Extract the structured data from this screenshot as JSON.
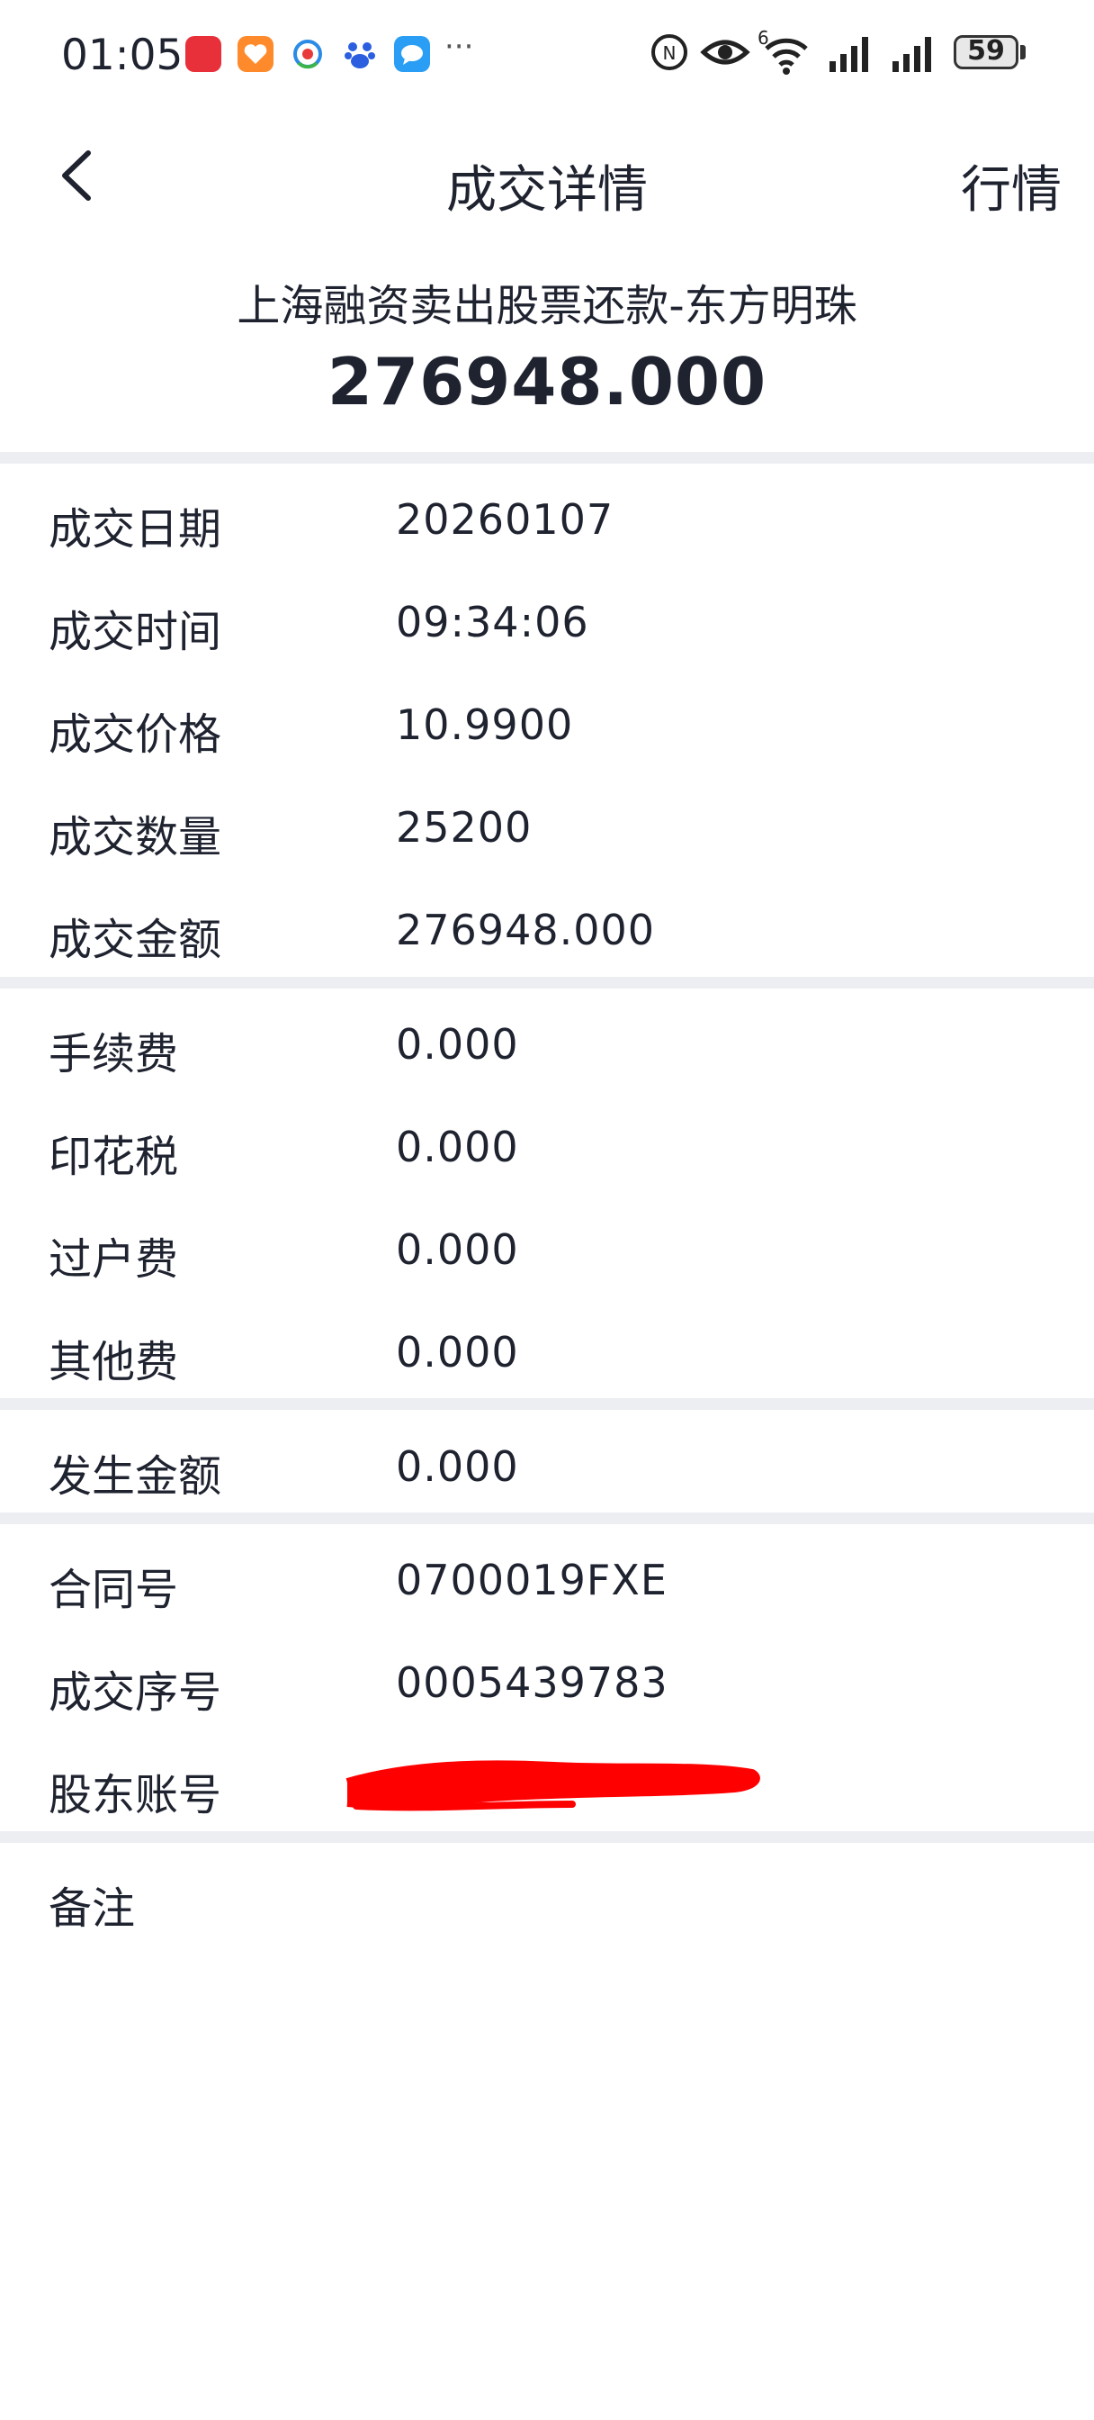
{
  "status_bar": {
    "time": "01:05",
    "battery": "59",
    "network_badge": "6",
    "icons": [
      "huawei-app-icon",
      "health-app-icon",
      "colorful-app-icon",
      "baidu-app-icon",
      "message-app-icon",
      "more-dots-icon",
      "nfc-icon",
      "eye-icon",
      "wifi-icon",
      "signal-icon",
      "signal-icon",
      "battery-icon"
    ]
  },
  "nav": {
    "title": "成交详情",
    "right": "行情"
  },
  "header": {
    "name": "上海融资卖出股票还款-东方明珠",
    "amount": "276948.000"
  },
  "sections": {
    "trade": [
      {
        "label": "成交日期",
        "value": "20260107"
      },
      {
        "label": "成交时间",
        "value": "09:34:06"
      },
      {
        "label": "成交价格",
        "value": "10.9900"
      },
      {
        "label": "成交数量",
        "value": "25200"
      },
      {
        "label": "成交金额",
        "value": "276948.000"
      }
    ],
    "fees": [
      {
        "label": "手续费",
        "value": "0.000"
      },
      {
        "label": "印花税",
        "value": "0.000"
      },
      {
        "label": "过户费",
        "value": "0.000"
      },
      {
        "label": "其他费",
        "value": "0.000"
      }
    ],
    "amount": [
      {
        "label": "发生金额",
        "value": "0.000"
      }
    ],
    "ids": [
      {
        "label": "合同号",
        "value": "0700019FXE"
      },
      {
        "label": "成交序号",
        "value": "0005439783"
      },
      {
        "label": "股东账号",
        "value": ""
      }
    ],
    "remark": [
      {
        "label": "备注",
        "value": ""
      }
    ]
  },
  "colors": {
    "redaction": "#ff0000",
    "divider": "#eceef2",
    "text": "#1f2330"
  }
}
